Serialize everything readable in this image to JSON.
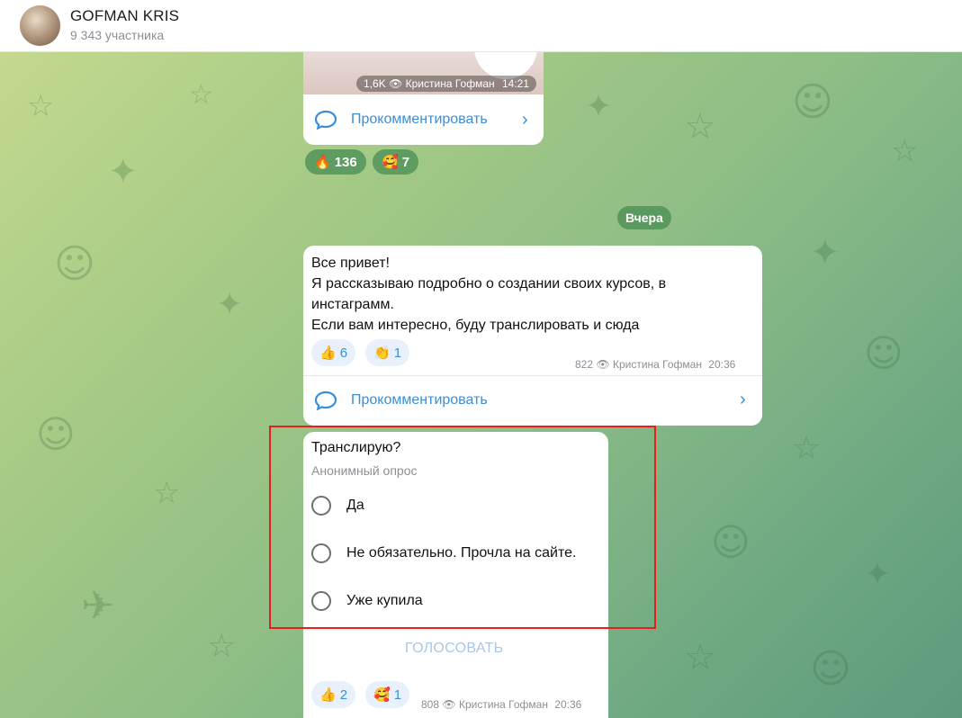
{
  "header": {
    "title": "GOFMAN KRIS",
    "subtitle": "9 343 участника"
  },
  "post1": {
    "views": "1,6K",
    "author": "Кристина Гофман",
    "time": "14:21",
    "comment_label": "Прокомментировать",
    "reactions": [
      {
        "emoji": "🔥",
        "count": "136"
      },
      {
        "emoji": "🥰",
        "count": "7"
      }
    ]
  },
  "date_separator": "Вчера",
  "post2": {
    "text": "Все привет!\nЯ рассказываю подробно о создании своих курсов, в инстаграмм.\nЕсли вам интересно, буду транслировать и сюда",
    "reactions": [
      {
        "emoji": "👍",
        "count": "6"
      },
      {
        "emoji": "👏",
        "count": "1"
      }
    ],
    "views": "822",
    "author": "Кристина Гофман",
    "time": "20:36",
    "comment_label": "Прокомментировать"
  },
  "poll": {
    "question": "Транслирую?",
    "type_label": "Анонимный опрос",
    "options": [
      "Да",
      "Не обязательно. Прочла на сайте.",
      "Уже купила"
    ],
    "vote_label": "ГОЛОСОВАТЬ",
    "reactions": [
      {
        "emoji": "👍",
        "count": "2"
      },
      {
        "emoji": "🥰",
        "count": "1"
      }
    ],
    "views": "808",
    "author": "Кристина Гофман",
    "time": "20:36"
  },
  "colors": {
    "accent": "#3a8fd8",
    "highlight": "#e81e1e",
    "reaction_bg": "#5e9c62"
  }
}
